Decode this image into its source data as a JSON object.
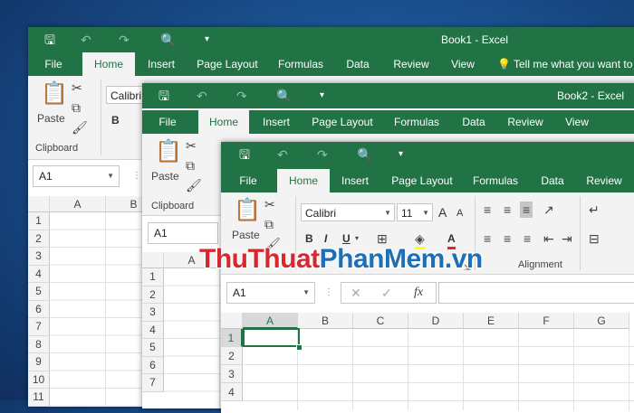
{
  "qat": {
    "save": "🖫",
    "undo": "↶",
    "redo": "↷",
    "preview": "🔍",
    "more": "▾"
  },
  "book1": {
    "title": "Book1 - Excel",
    "tabs": [
      "File",
      "Home",
      "Insert",
      "Page Layout",
      "Formulas",
      "Data",
      "Review",
      "View"
    ],
    "tell_me": "Tell me what you want to",
    "font_name": "Calibri",
    "paste": "Paste",
    "group_clipboard": "Clipboard",
    "name_box": "A1",
    "columns": [
      "A",
      "B"
    ],
    "rows": [
      "1",
      "2",
      "3",
      "4",
      "5",
      "6",
      "7",
      "8",
      "9",
      "10",
      "11"
    ]
  },
  "book2": {
    "title": "Book2 - Excel",
    "tabs": [
      "File",
      "Home",
      "Insert",
      "Page Layout",
      "Formulas",
      "Data",
      "Review",
      "View"
    ],
    "paste": "Paste",
    "group_clipboard": "Clipboard",
    "name_box": "A1",
    "columns": [
      "A"
    ],
    "rows": [
      "1",
      "2",
      "3",
      "4",
      "5",
      "6",
      "7"
    ]
  },
  "book3": {
    "tabs": [
      "File",
      "Home",
      "Insert",
      "Page Layout",
      "Formulas",
      "Data",
      "Review"
    ],
    "paste": "Paste",
    "font_name": "Calibri",
    "font_size": "11",
    "group_alignment": "Alignment",
    "name_box": "A1",
    "fx": "fx",
    "cancel": "✕",
    "enter": "✓",
    "columns": [
      "A",
      "B",
      "C",
      "D",
      "E",
      "F",
      "G"
    ],
    "rows": [
      "1",
      "2",
      "3",
      "4"
    ],
    "bold": "B",
    "italic": "I",
    "underline": "U",
    "font_color_letter": "A",
    "grow": "A",
    "shrink": "A"
  },
  "watermark": {
    "thu": "Thu",
    "thuat": "Thuat",
    "phan": "Phan",
    "mem": "Mem",
    "vn": ".vn"
  },
  "colors": {
    "excel_green": "#217346",
    "wm_red": "#d7282f",
    "wm_blue": "#1e6fb8"
  }
}
